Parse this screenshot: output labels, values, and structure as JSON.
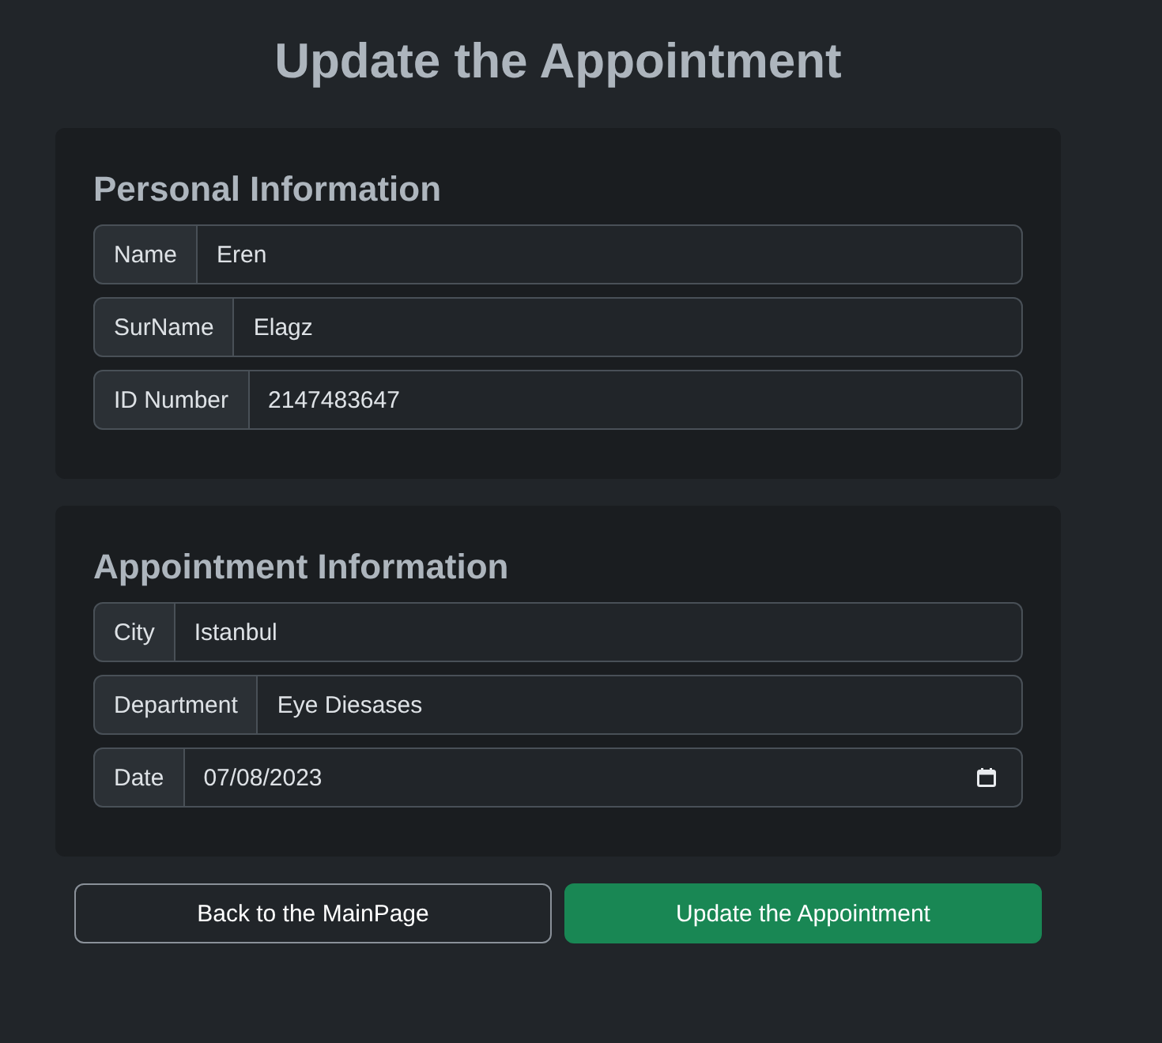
{
  "title": "Update the Appointment",
  "sections": [
    {
      "heading": "Personal Information",
      "fields": [
        {
          "label": "Name",
          "value": "Eren",
          "kind": "text"
        },
        {
          "label": "SurName",
          "value": "Elagz",
          "kind": "text"
        },
        {
          "label": "ID Number",
          "value": "2147483647",
          "kind": "text"
        }
      ]
    },
    {
      "heading": "Appointment Information",
      "fields": [
        {
          "label": "City",
          "value": "Istanbul",
          "kind": "text"
        },
        {
          "label": "Department",
          "value": "Eye Diesases",
          "kind": "text"
        },
        {
          "label": "Date",
          "value": "07/08/2023",
          "kind": "date"
        }
      ]
    }
  ],
  "buttons": [
    {
      "label": "Back to the MainPage",
      "kind": "outline"
    },
    {
      "label": "Update the Appointment",
      "kind": "primary"
    }
  ]
}
